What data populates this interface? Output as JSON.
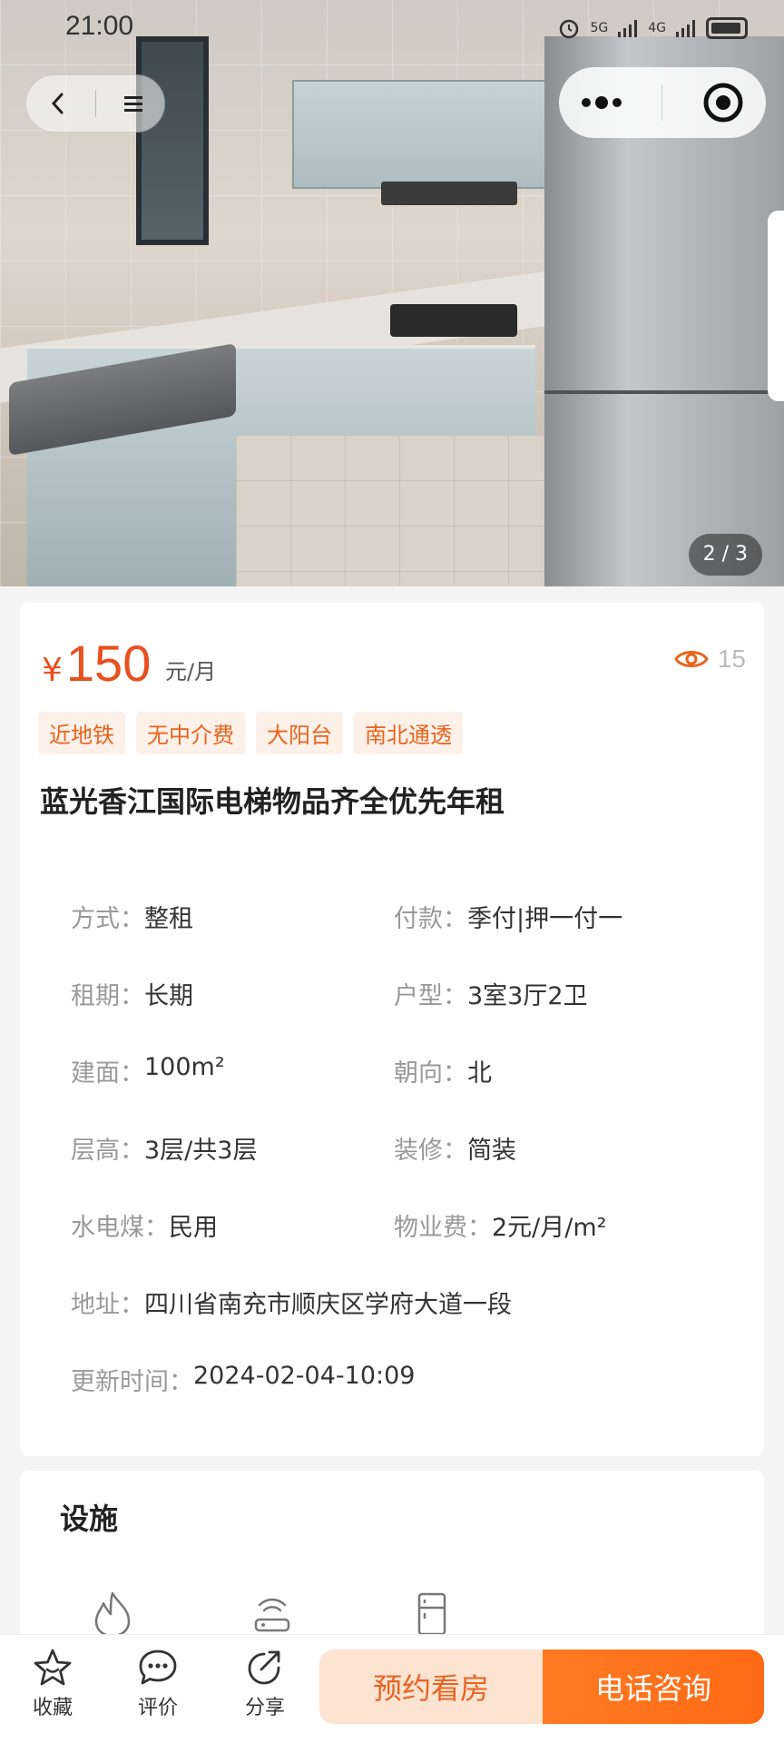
{
  "status_bar": {
    "time": "21:00",
    "network_labels": [
      "5G",
      "4G"
    ]
  },
  "gallery": {
    "counter": "2 / 3"
  },
  "listing": {
    "price_symbol": "¥",
    "price_value": "150",
    "price_unit": "元/月",
    "views": "15",
    "tags": [
      "近地铁",
      "无中介费",
      "大阳台",
      "南北通透"
    ],
    "title": "蓝光香江国际电梯物品齐全优先年租",
    "details": [
      [
        {
          "k": "方式：",
          "v": "整租"
        },
        {
          "k": "付款：",
          "v": "季付|押一付一"
        }
      ],
      [
        {
          "k": "租期：",
          "v": "长期"
        },
        {
          "k": "户型：",
          "v": "3室3厅2卫"
        }
      ],
      [
        {
          "k": "建面：",
          "v": "100m²"
        },
        {
          "k": "朝向：",
          "v": "北"
        }
      ],
      [
        {
          "k": "层高：",
          "v": "3层/共3层"
        },
        {
          "k": "装修：",
          "v": "简装"
        }
      ],
      [
        {
          "k": "水电煤：",
          "v": "民用"
        },
        {
          "k": "物业费：",
          "v": "2元/月/m²"
        }
      ],
      [
        {
          "k": "地址：",
          "v": "四川省南充市顺庆区学府大道一段"
        }
      ],
      [
        {
          "k": "更新时间：",
          "v": "2024-02-04-10:09"
        }
      ]
    ]
  },
  "facilities": {
    "title": "设施",
    "icons": [
      "gas-icon",
      "router-icon",
      "fridge-icon"
    ]
  },
  "bottom_bar": {
    "favorite_label": "收藏",
    "review_label": "评价",
    "share_label": "分享",
    "book_label": "预约看房",
    "call_label": "电话咨询"
  },
  "colors": {
    "accent": "#e8501e",
    "cta_gradient_start": "#ff7a22",
    "tag_bg": "#fdf0e8"
  }
}
